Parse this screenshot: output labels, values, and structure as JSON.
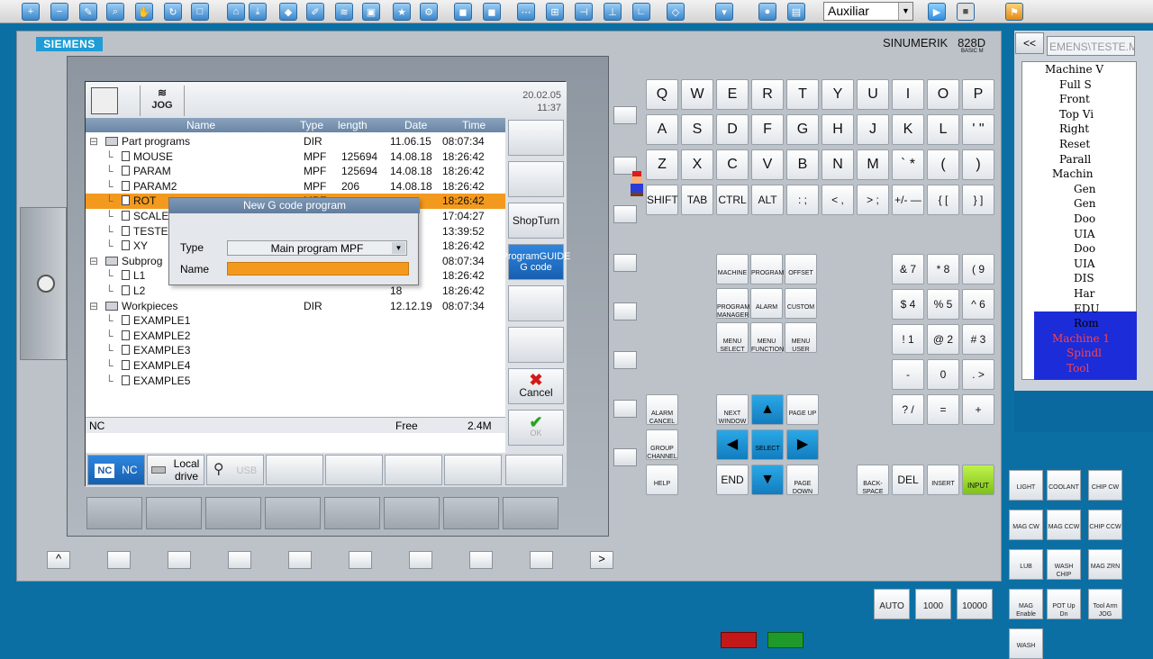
{
  "toolbar": {
    "combo_value": "Auxiliar"
  },
  "header": {
    "brand": "SIEMENS",
    "model": "SINUMERIK",
    "model_no": "828D",
    "model_sub": "BASIC M"
  },
  "screen": {
    "mode": "JOG",
    "date": "20.02.05",
    "time": "11:37",
    "columns": [
      "Name",
      "Type",
      "length",
      "Date",
      "Time"
    ],
    "rows": [
      {
        "name": "Part programs",
        "type": "DIR",
        "len": "",
        "date": "11.06.15",
        "time": "08:07:34",
        "lvl": 0,
        "folder": true
      },
      {
        "name": "MOUSE",
        "type": "MPF",
        "len": "125694",
        "date": "14.08.18",
        "time": "18:26:42",
        "lvl": 1
      },
      {
        "name": "PARAM",
        "type": "MPF",
        "len": "125694",
        "date": "14.08.18",
        "time": "18:26:42",
        "lvl": 1
      },
      {
        "name": "PARAM2",
        "type": "MPF",
        "len": "206",
        "date": "14.08.18",
        "time": "18:26:42",
        "lvl": 1
      },
      {
        "name": "ROT",
        "type": "MPF",
        "len": "",
        "date": "",
        "time": "18:26:42",
        "lvl": 1,
        "sel": true
      },
      {
        "name": "SCALE",
        "type": "",
        "len": "",
        "date": "03",
        "time": "17:04:27",
        "lvl": 1
      },
      {
        "name": "TESTE",
        "type": "",
        "len": "",
        "date": "04",
        "time": "13:39:52",
        "lvl": 1
      },
      {
        "name": "XY",
        "type": "",
        "len": "",
        "date": "18",
        "time": "18:26:42",
        "lvl": 1
      },
      {
        "name": "Subprog",
        "type": "",
        "len": "",
        "date": "03",
        "time": "08:07:34",
        "lvl": 0,
        "folder": true
      },
      {
        "name": "L1",
        "type": "",
        "len": "",
        "date": "18",
        "time": "18:26:42",
        "lvl": 1
      },
      {
        "name": "L2",
        "type": "",
        "len": "",
        "date": "18",
        "time": "18:26:42",
        "lvl": 1
      },
      {
        "name": "Workpieces",
        "type": "DIR",
        "len": "",
        "date": "12.12.19",
        "time": "08:07:34",
        "lvl": 0,
        "folder": true
      },
      {
        "name": "EXAMPLE1",
        "type": "",
        "len": "",
        "date": "",
        "time": "",
        "lvl": 1
      },
      {
        "name": "EXAMPLE2",
        "type": "",
        "len": "",
        "date": "",
        "time": "",
        "lvl": 1
      },
      {
        "name": "EXAMPLE3",
        "type": "",
        "len": "",
        "date": "",
        "time": "",
        "lvl": 1
      },
      {
        "name": "EXAMPLE4",
        "type": "",
        "len": "",
        "date": "",
        "time": "",
        "lvl": 1
      },
      {
        "name": "EXAMPLE5",
        "type": "",
        "len": "",
        "date": "",
        "time": "",
        "lvl": 1
      }
    ],
    "dialog": {
      "title": "New G code program",
      "type_label": "Type",
      "type_value": "Main program MPF",
      "name_label": "Name",
      "name_value": ""
    },
    "status": {
      "left": "NC",
      "free_label": "Free",
      "free_value": "2.4M"
    },
    "softkeys_right": {
      "shopturn": "ShopTurn",
      "programguide": "ProgramGUIDE",
      "gcode": "G code",
      "cancel": "Cancel",
      "ok": "OK"
    },
    "softkeys_bottom": {
      "nc": "NC",
      "local": "Local",
      "drive": "drive",
      "usb": "USB"
    }
  },
  "keys": {
    "row1": [
      "Q",
      "W",
      "E",
      "R",
      "T",
      "Y",
      "U",
      "I",
      "O",
      "P"
    ],
    "row2": [
      "A",
      "S",
      "D",
      "F",
      "G",
      "H",
      "J",
      "K",
      "L",
      "' \""
    ],
    "row3": [
      "Z",
      "X",
      "C",
      "V",
      "B",
      "N",
      "M",
      "` *",
      "( ",
      "  )"
    ],
    "row4": [
      "SHIFT",
      "TAB",
      "CTRL",
      "ALT",
      ": ;",
      "< ,",
      "> ;",
      "+/- —",
      "{ [",
      "} ]"
    ],
    "num": [
      "& 7",
      "* 8",
      "( 9",
      "$ 4",
      "% 5",
      "^ 6",
      "! 1",
      "@ 2",
      "# 3",
      "-",
      "0",
      ". >",
      "? /",
      "=",
      "+"
    ],
    "func": [
      [
        "MACHINE"
      ],
      [
        "PROGRAM"
      ],
      [
        "OFFSET"
      ],
      [
        "PROGRAM MANAGER"
      ],
      [
        "ALARM"
      ],
      [
        "CUSTOM"
      ],
      [
        "MENU SELECT"
      ],
      [
        "MENU FUNCTION"
      ],
      [
        "MENU USER"
      ]
    ],
    "nav": {
      "alarm": "ALARM CANCEL",
      "group": "GROUP CHANNEL",
      "help": "HELP",
      "next": "NEXT WINDOW",
      "pgup": "PAGE UP",
      "select": "SELECT",
      "end": "END",
      "pgdn": "PAGE DOWN"
    },
    "edit": {
      "back": "BACK-SPACE",
      "del": "DEL",
      "insert": "INSERT",
      "input": "INPUT"
    }
  },
  "rightpanel": {
    "path": "EMENS\\TESTE.M",
    "tree": [
      "Machine V",
      "Full S",
      "Front",
      "Top Vi",
      "Right",
      "Reset",
      "Parall",
      "Machin",
      "Gen",
      "Gen",
      "Doo",
      "UIA",
      "Doo",
      "UIA",
      "DIS",
      "Har",
      "EDU",
      "Rom",
      "Machine 1",
      "Spindl",
      "Tool"
    ]
  },
  "machine_keys": [
    "LIGHT",
    "COOLANT",
    "CHIP CW",
    "MAG CW",
    "MAG CCW",
    "CHIP CCW",
    "LUB",
    "WASH CHIP",
    "MAG ZRN",
    "MAG Enable",
    "POT Up Dn",
    "Tool Arm JOG",
    "AUTO",
    "1000",
    "10000",
    "WASH"
  ]
}
